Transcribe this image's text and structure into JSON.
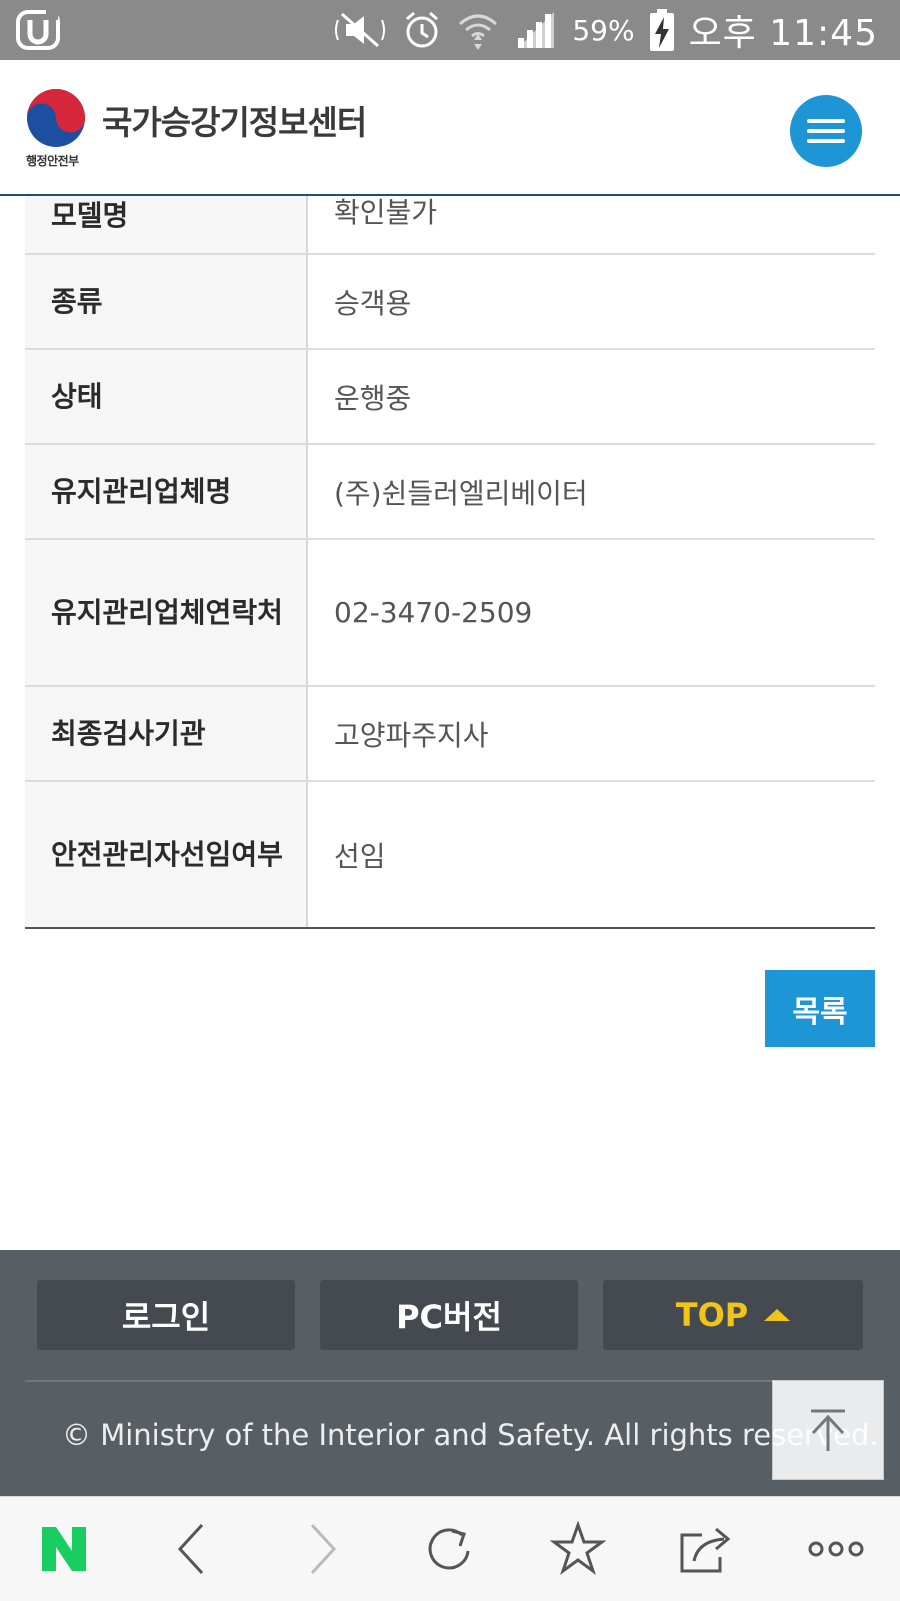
{
  "status_bar": {
    "battery": "59%",
    "time": "오후 11:45",
    "icons": [
      "carrier-u-icon",
      "mute-icon",
      "alarm-icon",
      "wifi-icon",
      "signal-icon",
      "battery-charging-icon"
    ]
  },
  "header": {
    "org_name": "행정안전부",
    "title": "국가승강기정보센터",
    "menu_icon": "hamburger-menu-icon"
  },
  "info_table": {
    "rows": [
      {
        "label": "모델명",
        "value": "확인불가"
      },
      {
        "label": "종류",
        "value": "승객용"
      },
      {
        "label": "상태",
        "value": "운행중"
      },
      {
        "label": "유지관리업체명",
        "value": "(주)쉰들러엘리베이터"
      },
      {
        "label": "유지관리업체연락처",
        "value": "02-3470-2509"
      },
      {
        "label": "최종검사기관",
        "value": "고양파주지사"
      },
      {
        "label": "안전관리자선임여부",
        "value": "선임"
      }
    ]
  },
  "list_button": "목록",
  "footer": {
    "login": "로그인",
    "pc_version": "PC버전",
    "top": "TOP",
    "copyright": "© Ministry of the Interior and Safety. All rights reserved."
  },
  "browser_bar": {
    "items": [
      "naver-n-icon",
      "back-icon",
      "forward-icon",
      "reload-icon",
      "bookmark-star-icon",
      "share-icon",
      "more-icon"
    ]
  },
  "colors": {
    "accent_blue": "#1e96d6",
    "header_border": "#1f4e79",
    "footer_bg": "#575e64",
    "top_yellow": "#f0c419",
    "naver_green": "#19ce60"
  }
}
